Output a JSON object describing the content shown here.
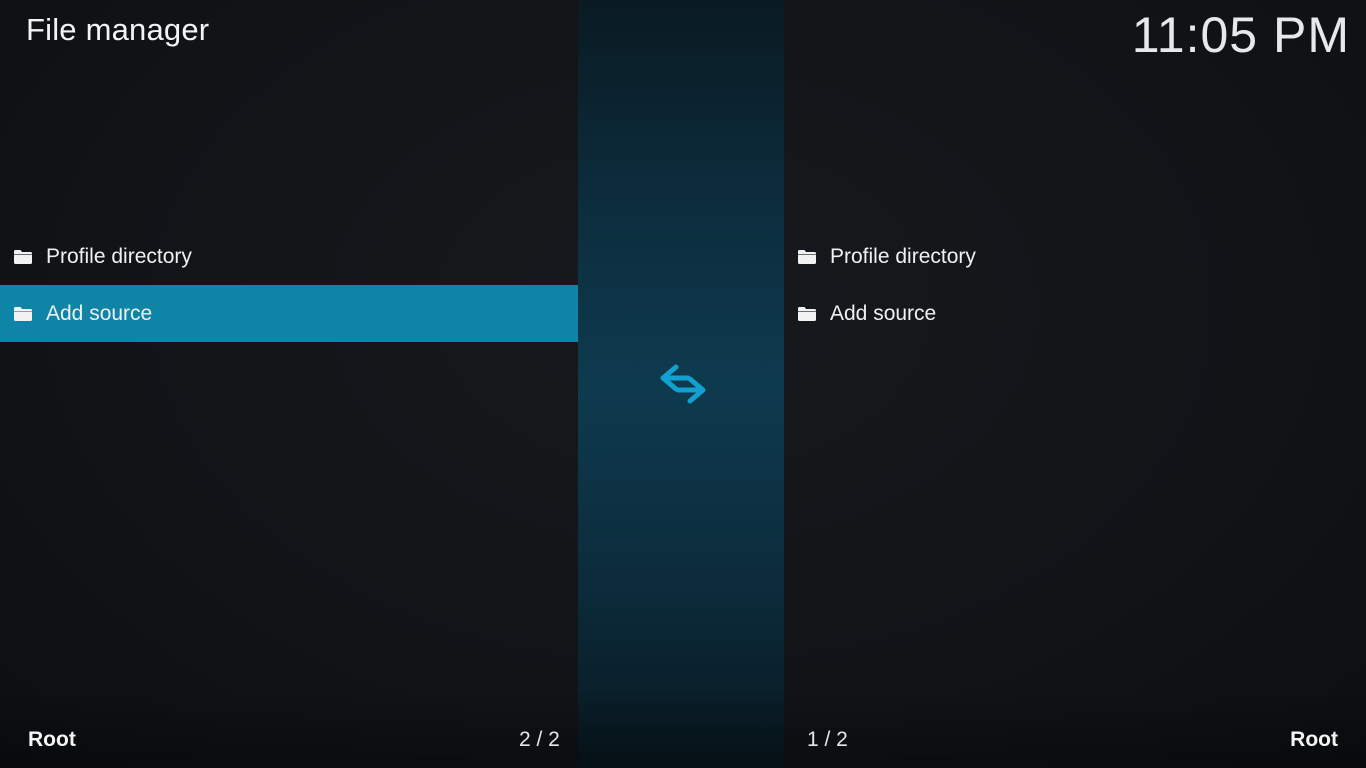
{
  "header": {
    "title": "File manager",
    "clock": "11:05 PM"
  },
  "left_pane": {
    "items": [
      {
        "label": "Profile directory",
        "icon": "folder-icon"
      },
      {
        "label": "Add source",
        "icon": "folder-icon",
        "selected": true
      }
    ],
    "path": "Root",
    "count": "2 / 2"
  },
  "right_pane": {
    "items": [
      {
        "label": "Profile directory",
        "icon": "folder-icon"
      },
      {
        "label": "Add source",
        "icon": "folder-icon"
      }
    ],
    "path": "Root",
    "count": "1 / 2"
  },
  "center": {
    "icon": "swap-arrows-icon"
  },
  "colors": {
    "selection": "#0e84a6",
    "accent_icon": "#12a0d0",
    "background": "#111417"
  }
}
